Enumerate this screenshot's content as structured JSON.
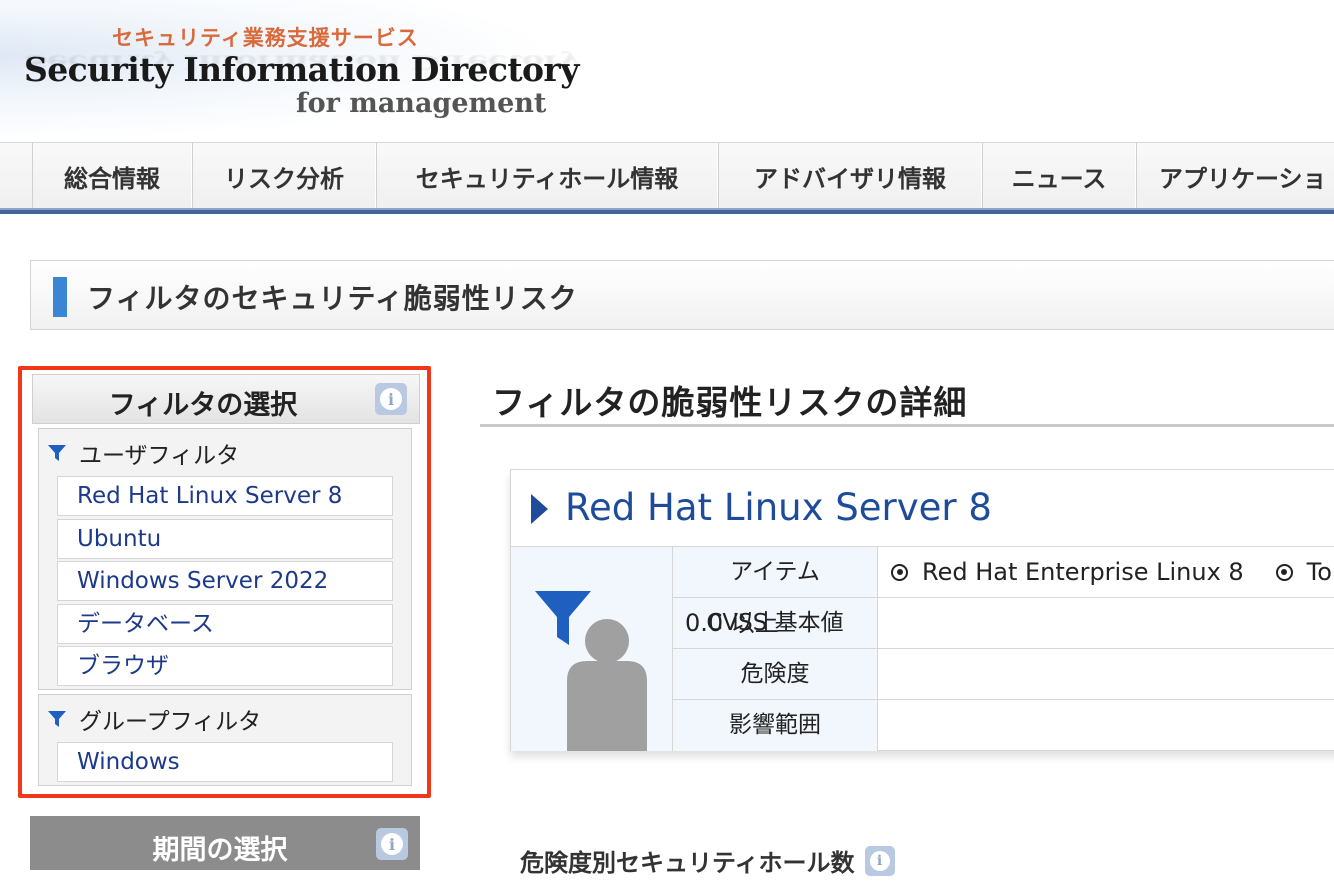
{
  "logo": {
    "tagline": "セキュリティ業務支援サービス",
    "title": "Security Information Directory",
    "subtitle": "for management"
  },
  "nav": {
    "items": [
      {
        "label": "総合情報"
      },
      {
        "label": "リスク分析"
      },
      {
        "label": "セキュリティホール情報"
      },
      {
        "label": "アドバイザリ情報"
      },
      {
        "label": "ニュース"
      },
      {
        "label": "アプリケーショ"
      }
    ]
  },
  "page": {
    "title": "フィルタのセキュリティ脆弱性リスク"
  },
  "filter_panel": {
    "title": "フィルタの選択",
    "info_icon": "info-icon",
    "user_filters": {
      "label": "ユーザフィルタ",
      "items": [
        {
          "label": "Red Hat Linux Server 8"
        },
        {
          "label": "Ubuntu"
        },
        {
          "label": "Windows Server 2022"
        },
        {
          "label": "データベース"
        },
        {
          "label": "ブラウザ"
        }
      ]
    },
    "group_filters": {
      "label": "グループフィルタ",
      "items": [
        {
          "label": "Windows"
        }
      ]
    },
    "highlight_color": "#f2361a"
  },
  "period_panel": {
    "title": "期間の選択"
  },
  "detail": {
    "title": "フィルタの脆弱性リスクの詳細",
    "card": {
      "name": "Red Hat Linux Server 8",
      "icon": "user-filter-icon",
      "rows": [
        {
          "label": "アイテム",
          "values": [
            "Red Hat Enterprise Linux 8",
            "To"
          ]
        },
        {
          "label": "CVSS 基本値",
          "value": "0.0 以上"
        },
        {
          "label": "危険度",
          "value": ""
        },
        {
          "label": "影響範囲",
          "value": ""
        }
      ]
    }
  },
  "counts": {
    "heading": "危険度別セキュリティホール数"
  },
  "colors": {
    "accent_blue": "#1e4c9a",
    "nav_bar": "#43659a",
    "title_accent": "#3a86d4",
    "period_header": "#8c8c8c"
  }
}
